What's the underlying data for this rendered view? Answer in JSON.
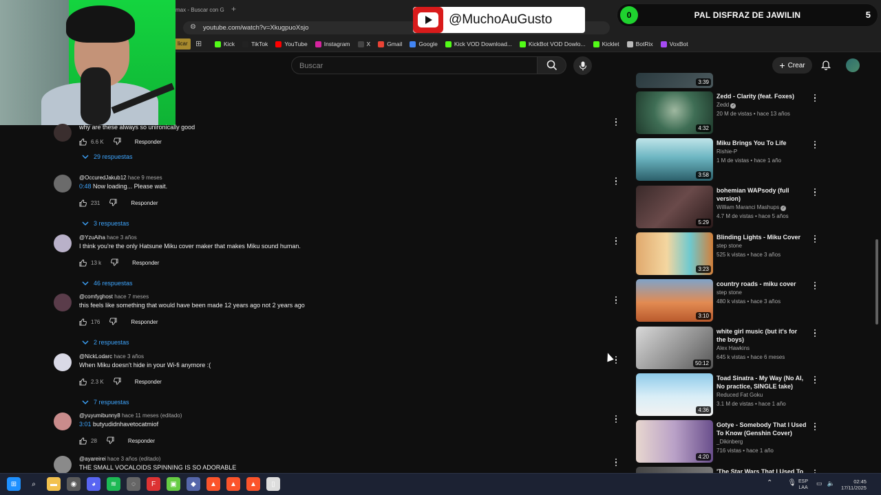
{
  "browser": {
    "tab_title": "max - Buscar con G",
    "new_tab": "+",
    "url": "youtube.com/watch?v=XkugpuoXsjo",
    "bookmark_first": "licar",
    "bookmarks": [
      {
        "label": "Kick",
        "color": "#53fc18"
      },
      {
        "label": "TikTok",
        "color": "#222222"
      },
      {
        "label": "YouTube",
        "color": "#ff0000"
      },
      {
        "label": "Instagram",
        "color": "#d6249f"
      },
      {
        "label": "X",
        "color": "#444444"
      },
      {
        "label": "Gmail",
        "color": "#ea4335"
      },
      {
        "label": "Google",
        "color": "#4285f4"
      },
      {
        "label": "Kick VOD Download...",
        "color": "#53fc18"
      },
      {
        "label": "KickBot VOD Dowlo...",
        "color": "#53fc18"
      },
      {
        "label": "Kicklet",
        "color": "#53fc18"
      },
      {
        "label": "BotRix",
        "color": "#bbbbbb"
      },
      {
        "label": "VoxBot",
        "color": "#a64bf4"
      }
    ]
  },
  "overlay": {
    "youtube_handle": "@MuchoAuGusto",
    "goal_count": "0",
    "goal_text": "PAL DISFRAZ DE JAWILIN",
    "goal_target": "5"
  },
  "header": {
    "search_placeholder": "Buscar",
    "create_label": "Crear"
  },
  "comments": [
    {
      "user": "",
      "time": "",
      "text": "why are these always so unironically good",
      "timestamp": "",
      "likes": "6.6 K",
      "reply_label": "Responder",
      "replies": "29 respuestas",
      "avatar": "#3a2e2e"
    },
    {
      "user": "@OccuredJakub12",
      "time": "hace 9 meses",
      "text": "Now loading... Please wait.",
      "timestamp": "0:48",
      "likes": "231",
      "reply_label": "Responder",
      "replies": "3 respuestas",
      "avatar": "#6b6b6b"
    },
    {
      "user": "@YzuAiha",
      "time": "hace 3 años",
      "text": "I think you're the only Hatsune Miku cover maker that makes Miku sound human.",
      "timestamp": "",
      "likes": "13 k",
      "reply_label": "Responder",
      "replies": "46 respuestas",
      "avatar": "#b9b1c9"
    },
    {
      "user": "@comfyghost",
      "time": "hace 7 meses",
      "text": "this feels like something that would have been made 12 years ago not 2 years ago",
      "timestamp": "",
      "likes": "176",
      "reply_label": "Responder",
      "replies": "2 respuestas",
      "avatar": "#5a3c4a"
    },
    {
      "user": "@NickLodarc",
      "time": "hace 3 años",
      "text": "When Miku doesn't hide in your Wi-fi anymore :(",
      "timestamp": "",
      "likes": "2.3 K",
      "reply_label": "Responder",
      "replies": "7 respuestas",
      "avatar": "#d9d9e6"
    },
    {
      "user": "@yuyumibunny8",
      "time": "hace 11 meses (editado)",
      "text": "butyudidnhavetocatmiof",
      "timestamp": "3:01",
      "likes": "28",
      "reply_label": "Responder",
      "replies": "",
      "avatar": "#c98c8c"
    },
    {
      "user": "@ayareirei",
      "time": "hace 3 años (editado)",
      "text": "THE SMALL VOCALOIDS SPINNING IS SO ADORABLE",
      "timestamp": "",
      "likes": "",
      "reply_label": "",
      "replies": "",
      "avatar": "#8a8a8a"
    }
  ],
  "videos": [
    {
      "title": "",
      "channel": "",
      "stats": "",
      "duration": "3:39",
      "verified": false,
      "thumb": "linear-gradient(135deg,#2a3a3f,#4c5a5e)"
    },
    {
      "title": "Zedd - Clarity (feat. Foxes)",
      "channel": "Zedd",
      "stats": "20 M de vistas • hace 13 años",
      "duration": "4:32",
      "verified": true,
      "thumb": "radial-gradient(circle at 50% 45%,#9fb8a0 0%,#3f6e55 45%,#1f3a2c 100%)"
    },
    {
      "title": "Miku Brings You To Life",
      "channel": "Rishie-P",
      "stats": "1 M de vistas • hace 1 año",
      "duration": "3:58",
      "verified": false,
      "thumb": "linear-gradient(180deg,#bfe4e9 0%,#6db6c2 45%,#2b5f6a 100%)"
    },
    {
      "title": "bohemian WAPsody (full version)",
      "channel": "William Maranci Mashups",
      "stats": "4.7 M de vistas • hace 5 años",
      "duration": "5:29",
      "verified": true,
      "thumb": "linear-gradient(135deg,#3a2a2a,#6a4a4a 50%,#2a1a1a)"
    },
    {
      "title": "Blinding Lights - Miku Cover",
      "channel": "step stone",
      "stats": "525 k vistas • hace 3 años",
      "duration": "3:23",
      "verified": false,
      "thumb": "linear-gradient(90deg,#e0a96d 0%,#f4d6a0 40%,#6ec9cf 70%,#d27f3a 100%)"
    },
    {
      "title": "country roads - miku cover",
      "channel": "step stone",
      "stats": "480 k vistas • hace 3 años",
      "duration": "3:10",
      "verified": false,
      "thumb": "linear-gradient(180deg,#7fa3c9 0%,#e28b52 55%,#b95a2d 100%)"
    },
    {
      "title": "white girl music (but it's for the boys)",
      "channel": "Alex Hawkins",
      "stats": "645 k vistas • hace 6 meses",
      "duration": "50:12",
      "verified": false,
      "thumb": "linear-gradient(135deg,#d9d9d9,#8d8d8d 60%,#555)"
    },
    {
      "title": "Toad Sinatra - My Way (No AI, No practice, SINGLE take)",
      "channel": "Reduced Fat Goku",
      "stats": "3.1 M de vistas • hace 1 año",
      "duration": "4:36",
      "verified": false,
      "thumb": "linear-gradient(180deg,#8fcbea 0%,#d9eef7 55%,#f2f2f2 100%)"
    },
    {
      "title": "Gotye - Somebody That I Used To Know (Genshin Cover)",
      "channel": "_Dikinberg",
      "stats": "716 vistas • hace 1 año",
      "duration": "4:20",
      "verified": false,
      "thumb": "linear-gradient(90deg,#e8d7cf 0%,#b9a1c7 50%,#6a4f8c 100%)"
    },
    {
      "title": "'The Star Wars That I Used To",
      "channel": "",
      "stats": "",
      "duration": "",
      "verified": false,
      "thumb": "linear-gradient(90deg,#444,#777)"
    }
  ],
  "taskbar": {
    "lang_top": "ESP",
    "lang_bottom": "LAA",
    "time": "02:45",
    "date": "17/11/2025"
  }
}
